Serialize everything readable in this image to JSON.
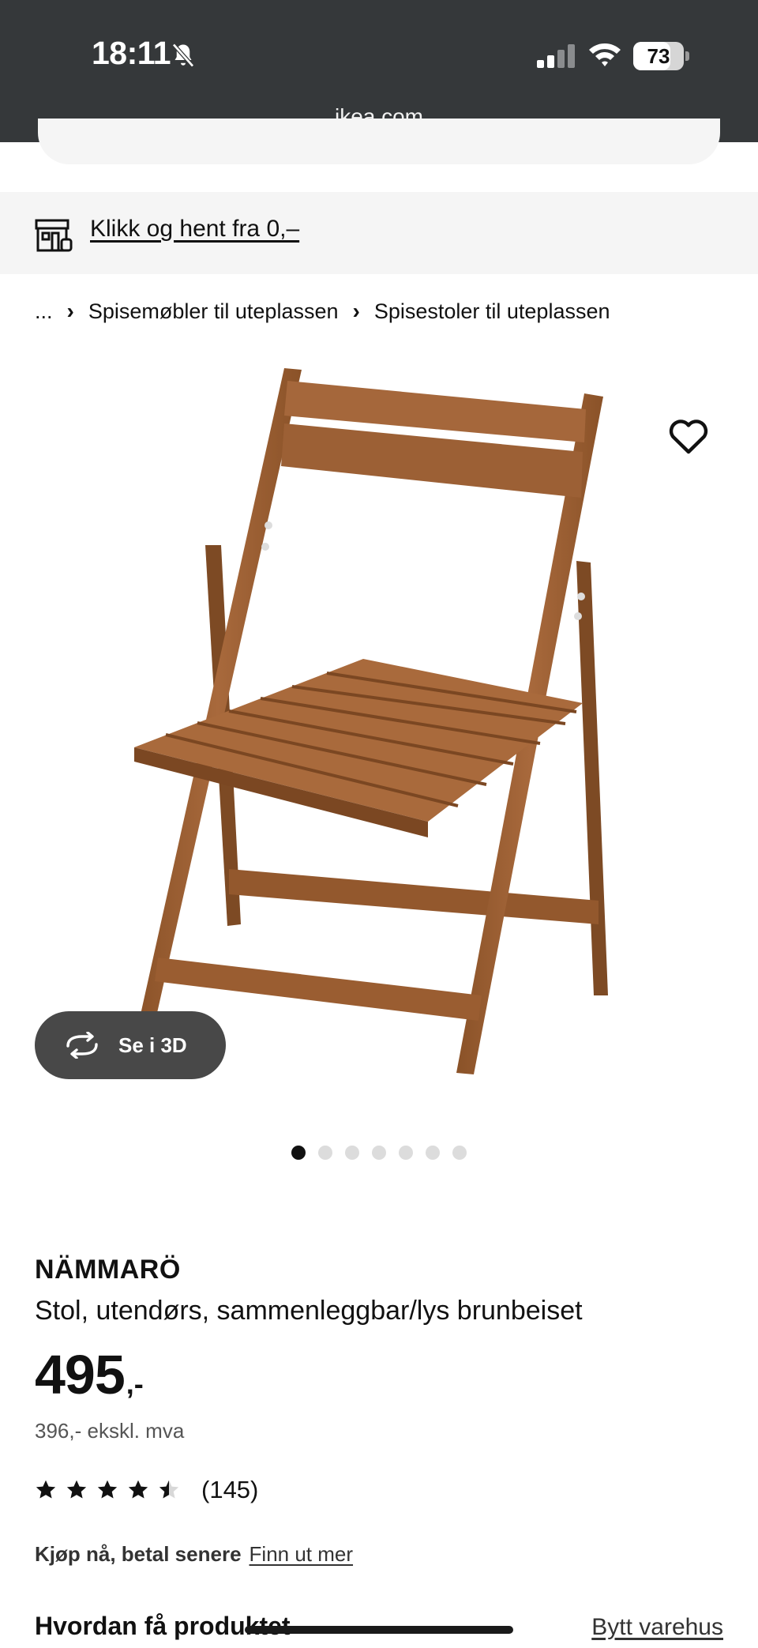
{
  "status_bar": {
    "time": "18:11",
    "battery": "73",
    "battery_level": 0.73,
    "icons": [
      "bell-slash-icon",
      "cellular-signal-icon",
      "wifi-icon",
      "battery-icon"
    ]
  },
  "browser": {
    "url": "ikea.com"
  },
  "banner": {
    "icon": "store-icon",
    "link_text": "Klikk og hent fra 0,–"
  },
  "breadcrumb": {
    "items": [
      "...",
      "Spisemøbler til uteplassen",
      "Spisestoler til uteplassen"
    ],
    "separator": "›"
  },
  "gallery": {
    "favorite_icon": "heart-icon",
    "view_3d_label": "Se i 3D",
    "view_3d_icon": "rotate-icon",
    "total_images": 7,
    "active_image": 1
  },
  "product": {
    "name": "NÄMMARÖ",
    "description": "Stol, utendørs, sammenleggbar/lys brunbeiset",
    "price": "495",
    "price_suffix": ",-",
    "price_ex_vat": "396,- ekskl. mva",
    "rating": 4.5,
    "rating_max": 5,
    "review_count": "(145)"
  },
  "payment": {
    "title": "Kjøp nå, betal senere",
    "link": "Finn ut mer"
  },
  "delivery": {
    "title": "Hvordan få produktet",
    "change_store": "Bytt varehus"
  },
  "colors": {
    "topbar": "#35383a",
    "banner_bg": "#f5f5f5",
    "button_3d": "#484848",
    "wood": "#9b5f34"
  }
}
